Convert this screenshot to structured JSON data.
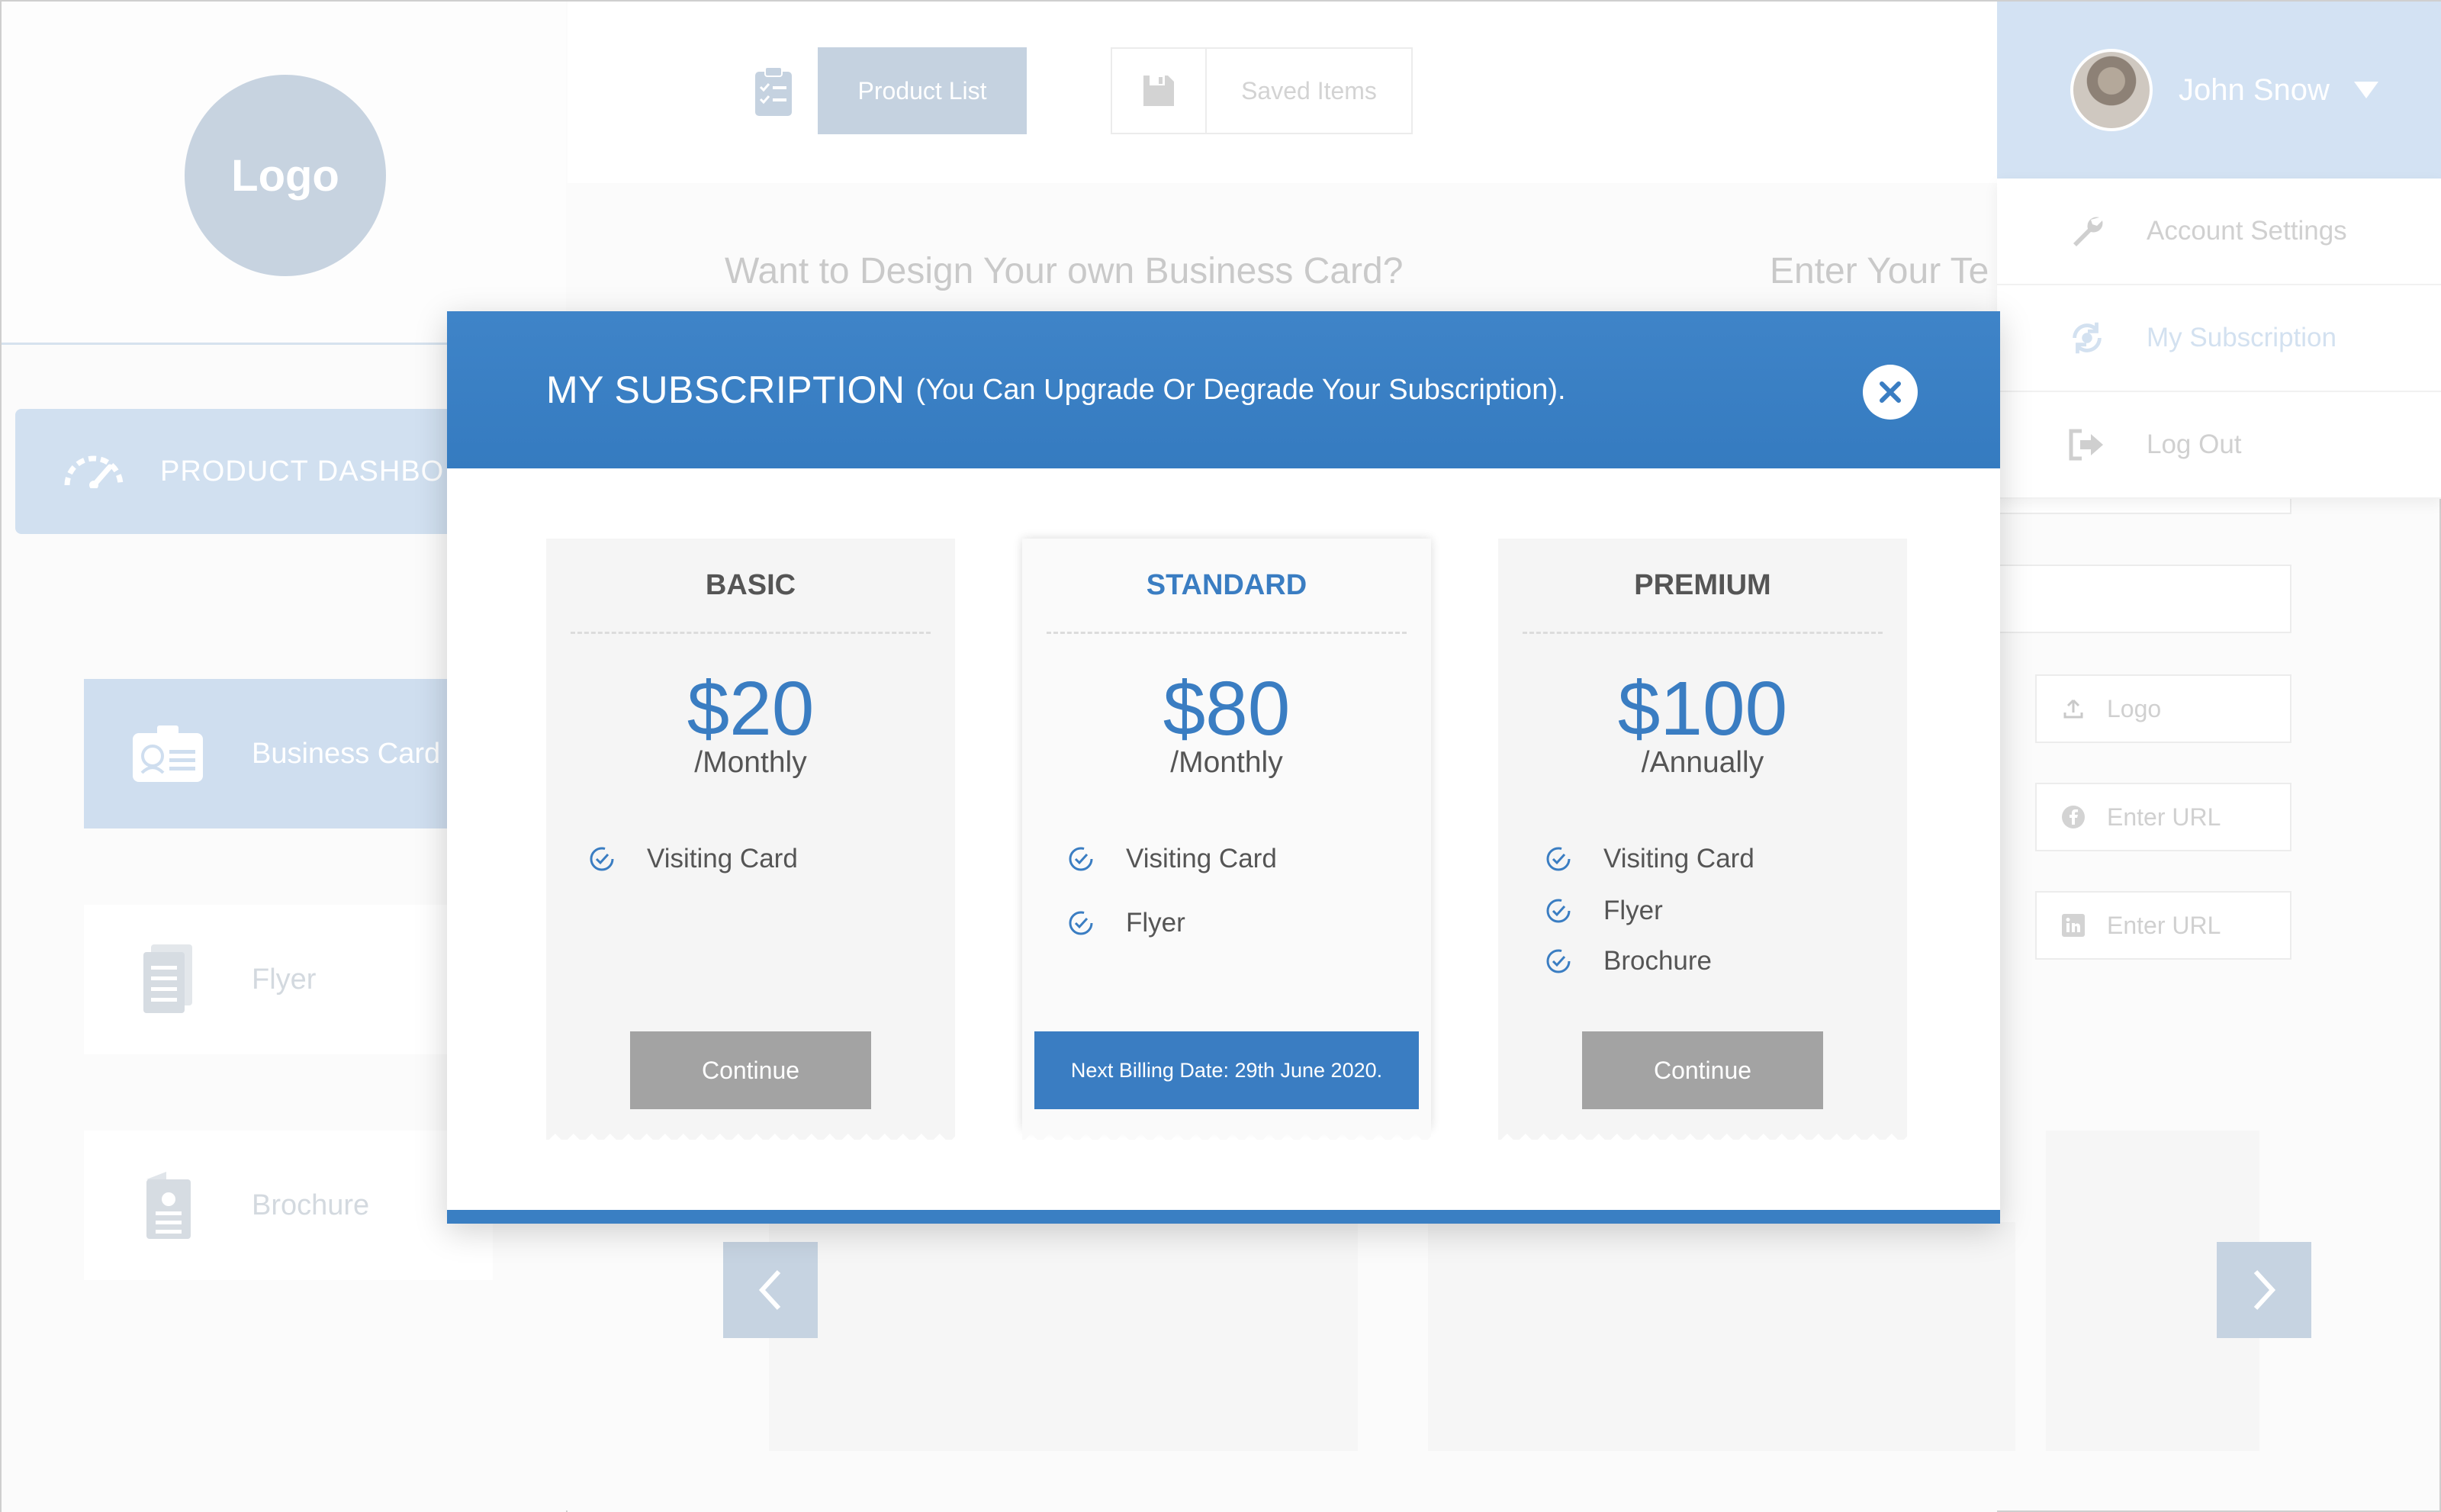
{
  "sidebar": {
    "logo_text": "Logo",
    "dashboard_label": "PRODUCT DASHBO",
    "items": [
      {
        "label": "Business Card",
        "icon": "id-card-icon"
      },
      {
        "label": "Flyer",
        "icon": "document-icon"
      },
      {
        "label": "Brochure",
        "icon": "brochure-icon"
      }
    ]
  },
  "toolbar": {
    "product_list_label": "Product List",
    "saved_items_label": "Saved Items"
  },
  "background": {
    "heading_left": "Want to Design Your own Business Card?",
    "heading_right": "Enter Your Te",
    "fields": [
      {
        "placeholder": "Logo",
        "icon": "upload-icon"
      },
      {
        "placeholder": "Enter URL",
        "icon": "facebook-icon"
      },
      {
        "placeholder": "Enter URL",
        "icon": "linkedin-icon"
      }
    ]
  },
  "user": {
    "name": "John Snow",
    "menu": [
      {
        "label": "Account Settings",
        "icon": "wrench-icon"
      },
      {
        "label": "My Subscription",
        "icon": "refresh-icon"
      },
      {
        "label": "Log Out",
        "icon": "logout-icon"
      }
    ]
  },
  "modal": {
    "title": "MY SUBSCRIPTION",
    "subtitle": "(You Can Upgrade Or Degrade Your Subscription).",
    "plans": [
      {
        "name": "BASIC",
        "price": "$20",
        "period": "/Monthly",
        "features": [
          "Visiting Card"
        ],
        "button": "Continue"
      },
      {
        "name": "STANDARD",
        "price": "$80",
        "period": "/Monthly",
        "features": [
          "Visiting Card",
          "Flyer"
        ],
        "button": "Next Billing Date: 29th June 2020."
      },
      {
        "name": "PREMIUM",
        "price": "$100",
        "period": "/Annually",
        "features": [
          "Visiting Card",
          "Flyer",
          "Brochure"
        ],
        "button": "Continue"
      }
    ]
  },
  "colors": {
    "accent": "#3a7dc2",
    "muted_blue": "#c6d3e1",
    "button_gray": "#a3a3a3"
  }
}
